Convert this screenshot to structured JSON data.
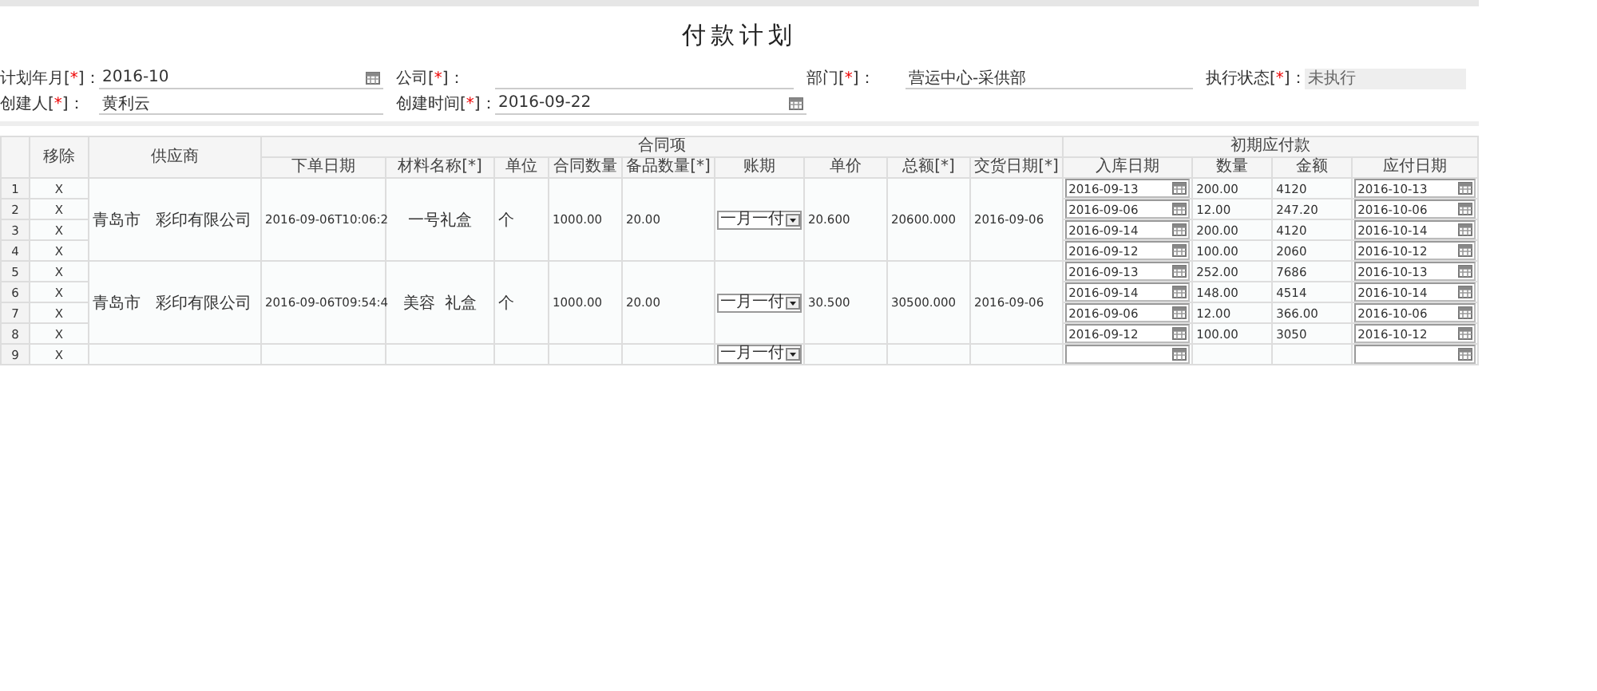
{
  "title": "付款计划",
  "form": [
    {
      "label": "计划年月[",
      "mark": "*",
      "tail": "]：",
      "value": "2016-10",
      "kind": "date"
    },
    {
      "label": "公司[",
      "mark": "*",
      "tail": "]：",
      "kind": "text"
    },
    {
      "label": "部门[",
      "mark": "*",
      "tail": "]：",
      "value": "营运中心-采供部",
      "kind": "text"
    },
    {
      "label": "执行状态[",
      "mark": "*",
      "tail": "]：",
      "value": "未执行",
      "kind": "readonly"
    },
    {
      "label": "创建人[",
      "mark": "*",
      "tail": "]：",
      "value": "黄利云",
      "kind": "text"
    },
    {
      "label": "创建时间[",
      "mark": "*",
      "tail": "]：",
      "value": "2016-09-22",
      "kind": "date"
    }
  ],
  "table": {
    "header_groups": [
      {
        "label": "移除"
      },
      {
        "label": "供应商"
      },
      {
        "label": "合同项",
        "columns": [
          "下单日期",
          "材料名称[*]",
          "单位",
          "合同数量",
          "备品数量[*]",
          "账期",
          "单价",
          "总额[*]",
          "交货日期[*]"
        ]
      },
      {
        "label": "初期应付款",
        "columns": [
          "入库日期",
          "数量",
          "金额",
          "应付日期"
        ]
      }
    ],
    "groups": [
      {
        "supplier": "青岛市   彩印有限公司",
        "order_date": "2016-09-06T10:06:2",
        "material": "一号礼盒",
        "unit": "个",
        "contract_qty": "1000.00",
        "spare_qty": "20.00",
        "term": "一月一付",
        "unit_price": "20.600",
        "total": "20600.000",
        "delivery_date": "2016-09-06",
        "lines": [
          {
            "row": "1",
            "remove": "X",
            "in_date": "2016-09-13",
            "qty": "200.00",
            "amount": "4120",
            "due_date": "2016-10-13"
          },
          {
            "row": "2",
            "remove": "X",
            "in_date": "2016-09-06",
            "qty": "12.00",
            "amount": "247.20",
            "due_date": "2016-10-06"
          },
          {
            "row": "3",
            "remove": "X",
            "in_date": "2016-09-14",
            "qty": "200.00",
            "amount": "4120",
            "due_date": "2016-10-14"
          },
          {
            "row": "4",
            "remove": "X",
            "in_date": "2016-09-12",
            "qty": "100.00",
            "amount": "2060",
            "due_date": "2016-10-12"
          }
        ]
      },
      {
        "supplier": "青岛市   彩印有限公司",
        "order_date": "2016-09-06T09:54:4",
        "material": "美容  礼盒",
        "unit": "个",
        "contract_qty": "1000.00",
        "spare_qty": "20.00",
        "term": "一月一付",
        "unit_price": "30.500",
        "total": "30500.000",
        "delivery_date": "2016-09-06",
        "lines": [
          {
            "row": "5",
            "remove": "X",
            "in_date": "2016-09-13",
            "qty": "252.00",
            "amount": "7686",
            "due_date": "2016-10-13"
          },
          {
            "row": "6",
            "remove": "X",
            "in_date": "2016-09-14",
            "qty": "148.00",
            "amount": "4514",
            "due_date": "2016-10-14"
          },
          {
            "row": "7",
            "remove": "X",
            "in_date": "2016-09-06",
            "qty": "12.00",
            "amount": "366.00",
            "due_date": "2016-10-06"
          },
          {
            "row": "8",
            "remove": "X",
            "in_date": "2016-09-12",
            "qty": "100.00",
            "amount": "3050",
            "due_date": "2016-10-12"
          }
        ]
      },
      {
        "term": "一月一付",
        "lines": [
          {
            "row": "9",
            "remove": "X"
          }
        ]
      }
    ]
  }
}
